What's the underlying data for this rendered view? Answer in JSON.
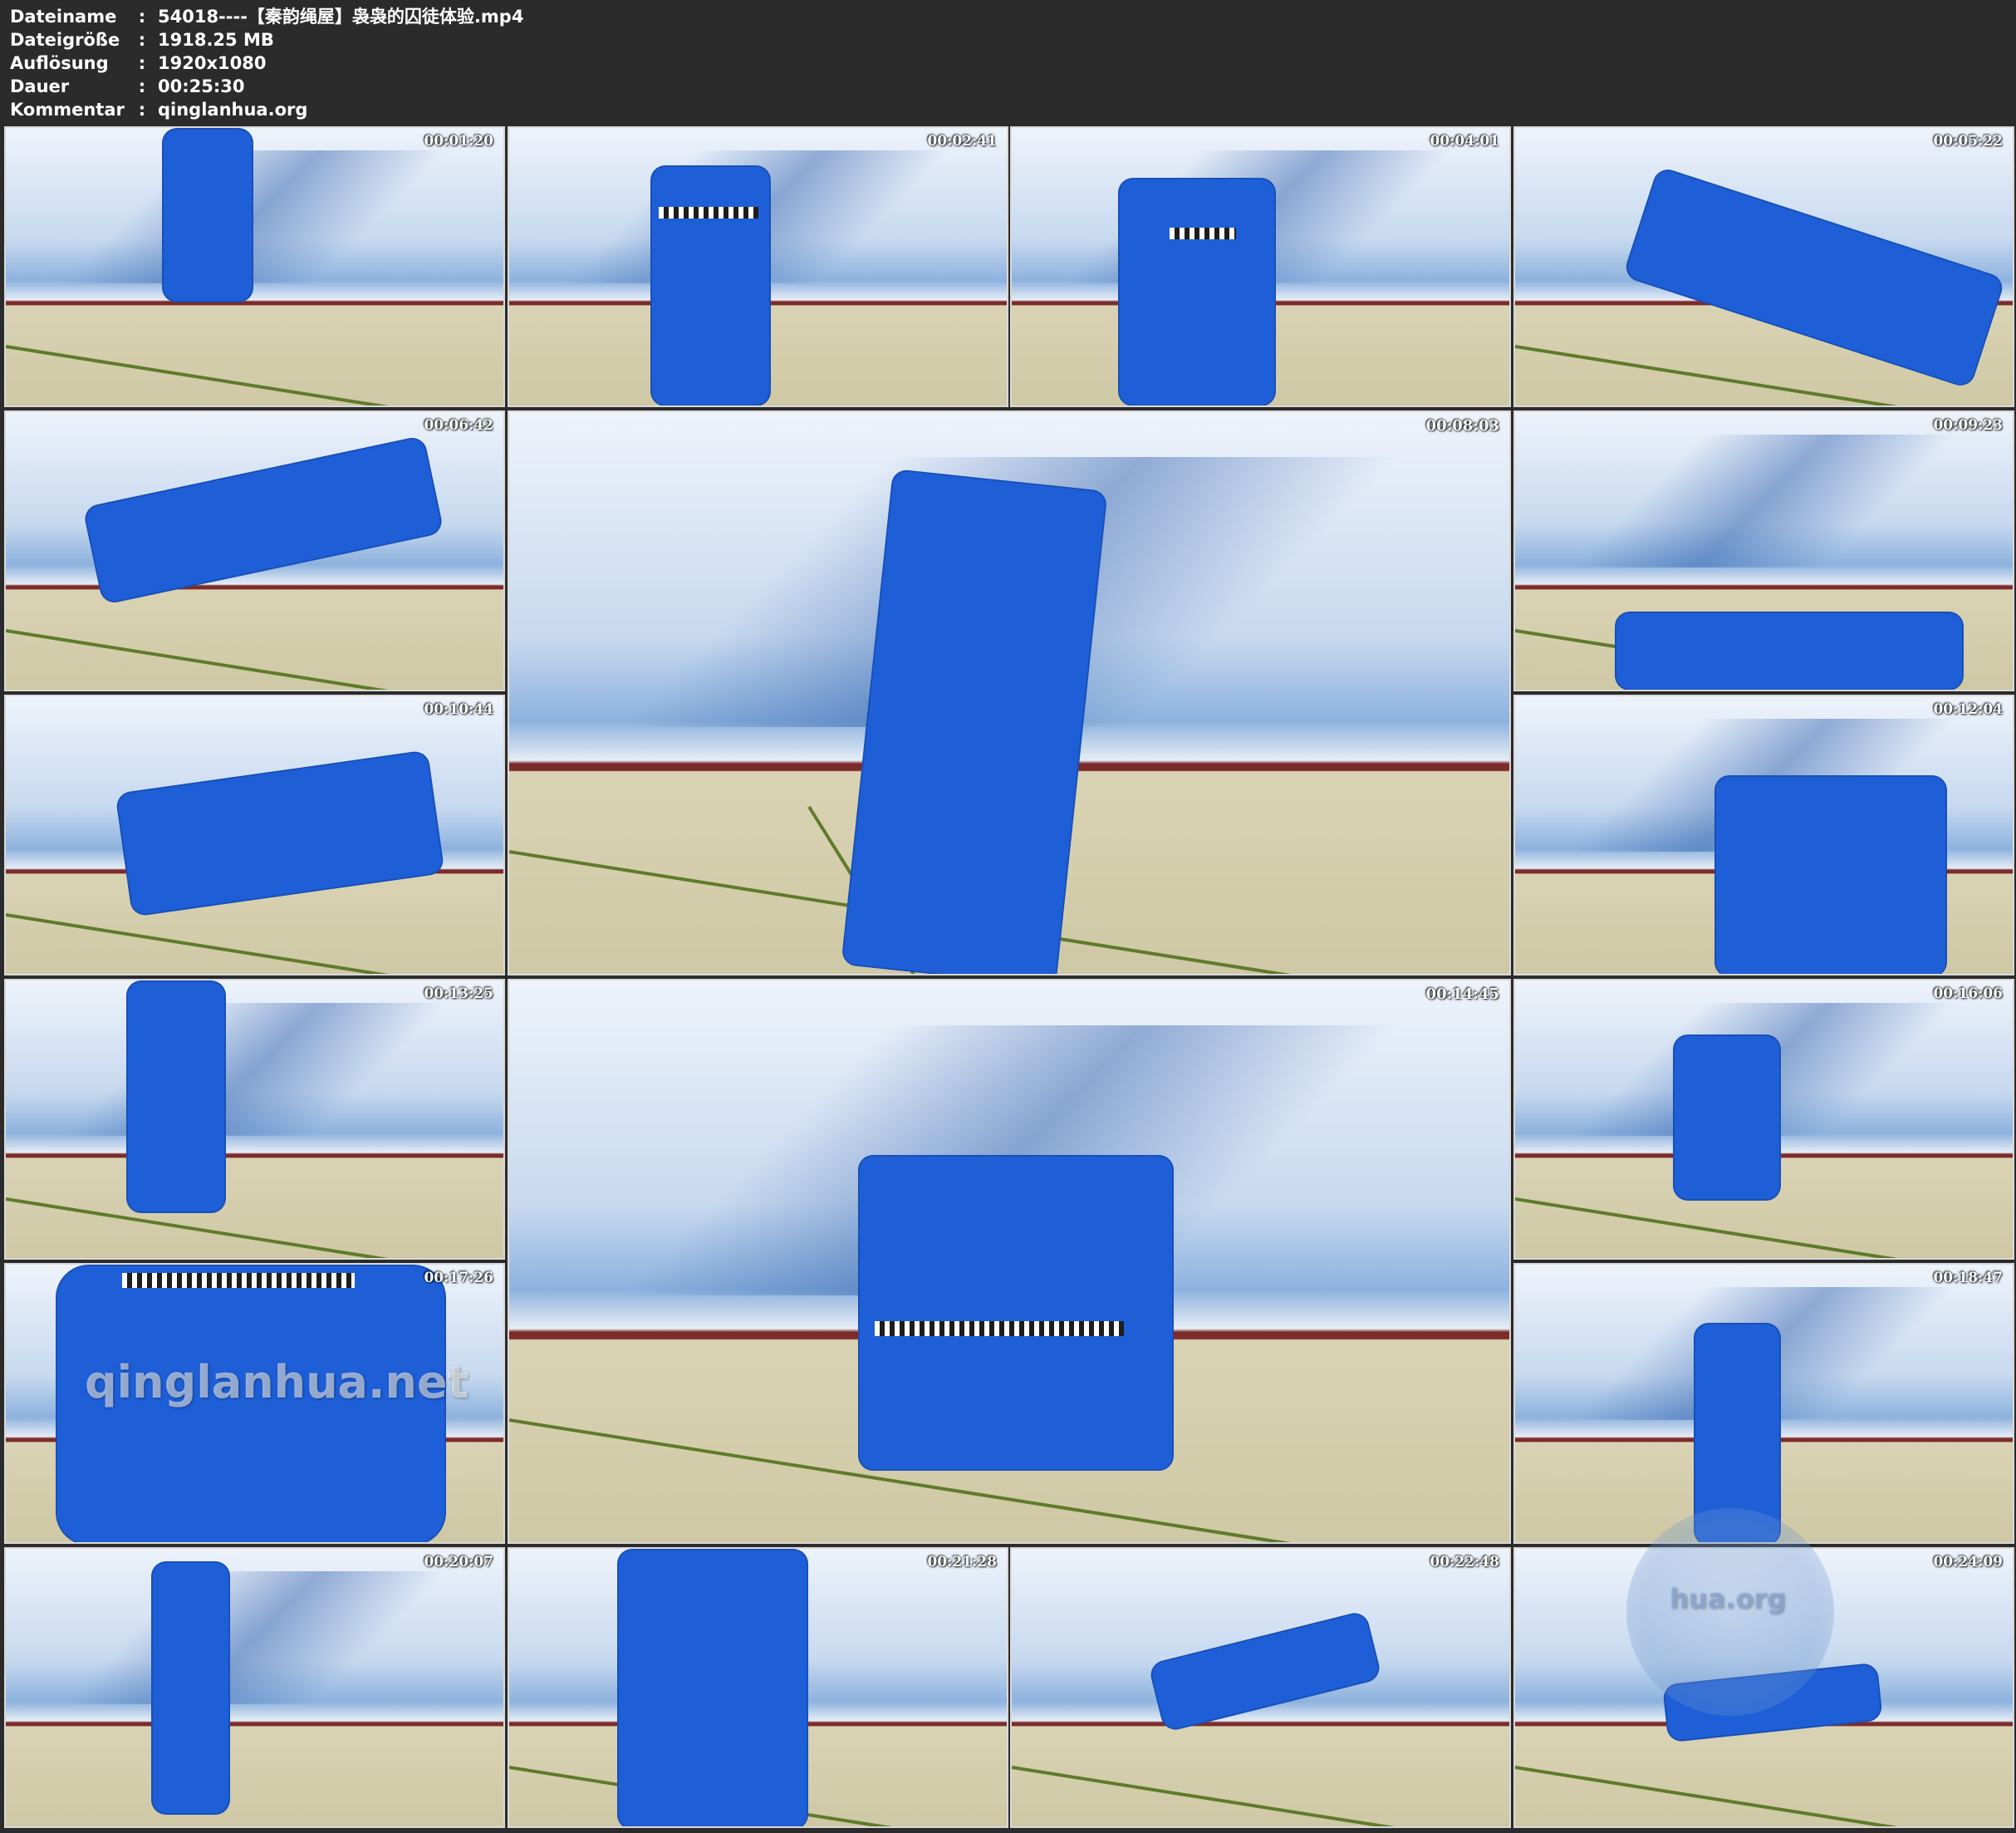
{
  "file_info": [
    {
      "key": "Dateiname",
      "sep": ":",
      "value": "54018----【秦韵绳屋】袅袅的囚徒体验.mp4"
    },
    {
      "key": "Dateigröße",
      "sep": ":",
      "value": "1918.25 MB"
    },
    {
      "key": "Auflösung",
      "sep": ":",
      "value": "1920x1080"
    },
    {
      "key": "Dauer",
      "sep": ":",
      "value": "00:25:30"
    },
    {
      "key": "Kommentar",
      "sep": ":",
      "value": "qinglanhua.org"
    }
  ],
  "thumbnails": [
    {
      "timestamp": "00:01:20"
    },
    {
      "timestamp": "00:02:41"
    },
    {
      "timestamp": "00:04:01"
    },
    {
      "timestamp": "00:05:22"
    },
    {
      "timestamp": "00:06:42"
    },
    {
      "timestamp": "00:08:03"
    },
    {
      "timestamp": "00:09:23"
    },
    {
      "timestamp": "00:10:44"
    },
    {
      "timestamp": "00:12:04"
    },
    {
      "timestamp": "00:13:25"
    },
    {
      "timestamp": "00:14:45"
    },
    {
      "timestamp": "00:16:06"
    },
    {
      "timestamp": "00:17:26"
    },
    {
      "timestamp": "00:18:47"
    },
    {
      "timestamp": "00:20:07"
    },
    {
      "timestamp": "00:21:28"
    },
    {
      "timestamp": "00:22:48"
    },
    {
      "timestamp": "00:24:09"
    }
  ],
  "watermarks": {
    "thumb_13": "qinglanhua.net",
    "corner_logo": "hua.org"
  },
  "colors": {
    "background": "#2b2b2b",
    "uniform_blue": "#1e5fd8",
    "wall_trim": "#7c2b2b",
    "tatami": "#d9d3b4"
  }
}
